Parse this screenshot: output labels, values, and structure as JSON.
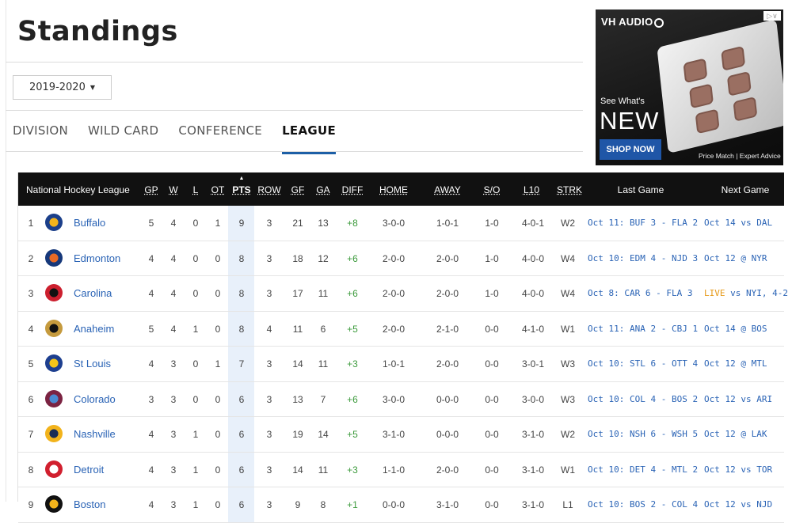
{
  "page": {
    "title": "Standings"
  },
  "season": {
    "label": "2019-2020"
  },
  "tabs": [
    "DIVISION",
    "WILD CARD",
    "CONFERENCE",
    "LEAGUE"
  ],
  "active_tab": "LEAGUE",
  "ad": {
    "brand": "VH AUDIO",
    "see": "See What's",
    "new": "NEW",
    "cta": "SHOP NOW",
    "tagline": "Price Match | Expert Advice"
  },
  "table": {
    "title": "National Hockey League",
    "headers": [
      "GP",
      "W",
      "L",
      "OT",
      "PTS",
      "ROW",
      "GF",
      "GA",
      "DIFF",
      "HOME",
      "AWAY",
      "S/O",
      "L10",
      "STRK",
      "Last Game",
      "Next Game"
    ],
    "rows": [
      {
        "rank": "1",
        "team": "Buffalo",
        "gp": "5",
        "w": "4",
        "l": "0",
        "ot": "1",
        "pts": "9",
        "row": "3",
        "gf": "21",
        "ga": "13",
        "diff": "+8",
        "home": "3-0-0",
        "away": "1-0-1",
        "so": "1-0",
        "l10": "4-0-1",
        "strk": "W2",
        "last": "Oct 11: BUF 3 - FLA 2",
        "next_pre": "",
        "next": "Oct 14 vs DAL",
        "logo": "#1b3f8a",
        "logo2": "#f2b31b"
      },
      {
        "rank": "2",
        "team": "Edmonton",
        "gp": "4",
        "w": "4",
        "l": "0",
        "ot": "0",
        "pts": "8",
        "row": "3",
        "gf": "18",
        "ga": "12",
        "diff": "+6",
        "home": "2-0-0",
        "away": "2-0-0",
        "so": "1-0",
        "l10": "4-0-0",
        "strk": "W4",
        "last": "Oct 10: EDM 4 - NJD 3",
        "next_pre": "",
        "next": "Oct 12 @ NYR",
        "logo": "#16387a",
        "logo2": "#e86a26"
      },
      {
        "rank": "3",
        "team": "Carolina",
        "gp": "4",
        "w": "4",
        "l": "0",
        "ot": "0",
        "pts": "8",
        "row": "3",
        "gf": "17",
        "ga": "11",
        "diff": "+6",
        "home": "2-0-0",
        "away": "2-0-0",
        "so": "1-0",
        "l10": "4-0-0",
        "strk": "W4",
        "last": "Oct 8: CAR 6 - FLA 3",
        "next_pre": "LIVE",
        "next": " vs NYI, 4-2",
        "logo": "#cc1f2e",
        "logo2": "#111111"
      },
      {
        "rank": "4",
        "team": "Anaheim",
        "gp": "5",
        "w": "4",
        "l": "1",
        "ot": "0",
        "pts": "8",
        "row": "4",
        "gf": "11",
        "ga": "6",
        "diff": "+5",
        "home": "2-0-0",
        "away": "2-1-0",
        "so": "0-0",
        "l10": "4-1-0",
        "strk": "W1",
        "last": "Oct 11: ANA 2 - CBJ 1",
        "next_pre": "",
        "next": "Oct 14 @ BOS",
        "logo": "#c59a3d",
        "logo2": "#111111"
      },
      {
        "rank": "5",
        "team": "St Louis",
        "gp": "4",
        "w": "3",
        "l": "0",
        "ot": "1",
        "pts": "7",
        "row": "3",
        "gf": "14",
        "ga": "11",
        "diff": "+3",
        "home": "1-0-1",
        "away": "2-0-0",
        "so": "0-0",
        "l10": "3-0-1",
        "strk": "W3",
        "last": "Oct 10: STL 6 - OTT 4",
        "next_pre": "",
        "next": "Oct 12 @ MTL",
        "logo": "#1d3f8f",
        "logo2": "#f5c518"
      },
      {
        "rank": "6",
        "team": "Colorado",
        "gp": "3",
        "w": "3",
        "l": "0",
        "ot": "0",
        "pts": "6",
        "row": "3",
        "gf": "13",
        "ga": "7",
        "diff": "+6",
        "home": "3-0-0",
        "away": "0-0-0",
        "so": "0-0",
        "l10": "3-0-0",
        "strk": "W3",
        "last": "Oct 10: COL 4 - BOS 2",
        "next_pre": "",
        "next": "Oct 12 vs ARI",
        "logo": "#7b2342",
        "logo2": "#4b8ad2"
      },
      {
        "rank": "7",
        "team": "Nashville",
        "gp": "4",
        "w": "3",
        "l": "1",
        "ot": "0",
        "pts": "6",
        "row": "3",
        "gf": "19",
        "ga": "14",
        "diff": "+5",
        "home": "3-1-0",
        "away": "0-0-0",
        "so": "0-0",
        "l10": "3-1-0",
        "strk": "W2",
        "last": "Oct 10: NSH 6 - WSH 5",
        "next_pre": "",
        "next": "Oct 12 @ LAK",
        "logo": "#f2b31b",
        "logo2": "#1a2c55"
      },
      {
        "rank": "8",
        "team": "Detroit",
        "gp": "4",
        "w": "3",
        "l": "1",
        "ot": "0",
        "pts": "6",
        "row": "3",
        "gf": "14",
        "ga": "11",
        "diff": "+3",
        "home": "1-1-0",
        "away": "2-0-0",
        "so": "0-0",
        "l10": "3-1-0",
        "strk": "W1",
        "last": "Oct 10: DET 4 - MTL 2",
        "next_pre": "",
        "next": "Oct 12 vs TOR",
        "logo": "#d11f2e",
        "logo2": "#ffffff"
      },
      {
        "rank": "9",
        "team": "Boston",
        "gp": "4",
        "w": "3",
        "l": "1",
        "ot": "0",
        "pts": "6",
        "row": "3",
        "gf": "9",
        "ga": "8",
        "diff": "+1",
        "home": "0-0-0",
        "away": "3-1-0",
        "so": "0-0",
        "l10": "3-1-0",
        "strk": "L1",
        "last": "Oct 10: BOS 2 - COL 4",
        "next_pre": "",
        "next": "Oct 12 vs NJD",
        "logo": "#111111",
        "logo2": "#f2b31b"
      }
    ]
  }
}
